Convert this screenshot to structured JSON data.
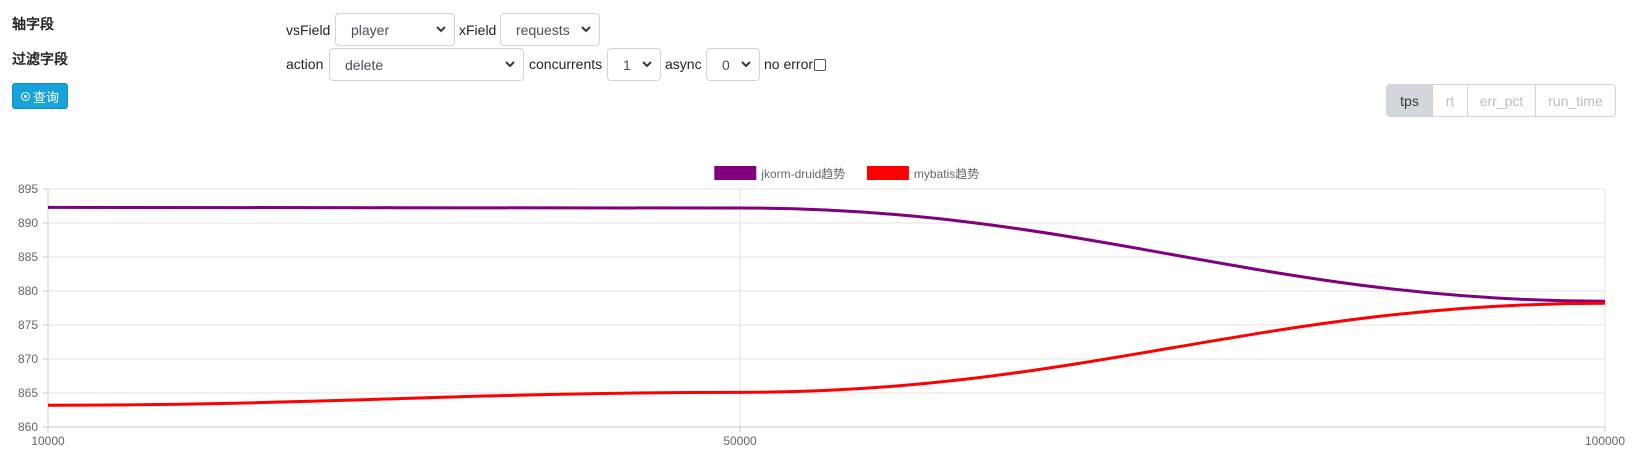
{
  "form": {
    "axis_field_label": "轴字段",
    "filter_field_label": "过滤字段",
    "query_button": "查询",
    "vsfield_label": "vsField",
    "vsfield_value": "player",
    "xfield_label": "xField",
    "xfield_value": "requests",
    "action_label": "action",
    "action_value": "delete",
    "concurrents_label": "concurrents",
    "concurrents_value": "1",
    "async_label": "async",
    "async_value": "0",
    "no_error_label": "no error",
    "no_error_checked": false
  },
  "metric_buttons": {
    "items": [
      "tps",
      "rt",
      "err_pct",
      "run_time"
    ],
    "active": "tps"
  },
  "chart_data": {
    "type": "line",
    "x": [
      10000,
      50000,
      100000
    ],
    "x_tick_labels": [
      "10000",
      "50000",
      "100000"
    ],
    "ylim": [
      860,
      895
    ],
    "y_ticks": [
      860,
      865,
      870,
      875,
      880,
      885,
      890,
      895
    ],
    "grid": true,
    "legend_position": "top-center",
    "series": [
      {
        "name": "jkorm-druid趋势",
        "color": "#800080",
        "values": [
          892.3,
          892.2,
          878.5
        ]
      },
      {
        "name": "mybatis趋势",
        "color": "#ff0000",
        "values": [
          863.2,
          865.1,
          878.2
        ]
      }
    ]
  }
}
